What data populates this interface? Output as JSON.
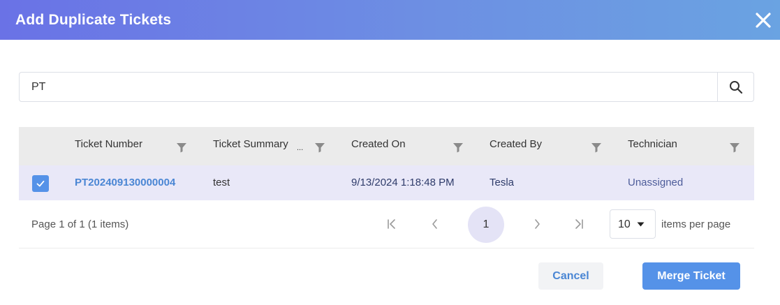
{
  "dialog": {
    "title": "Add Duplicate Tickets",
    "close_icon": "close-icon"
  },
  "search": {
    "value": "PT",
    "icon": "search-icon"
  },
  "grid": {
    "columns": [
      {
        "label": "Ticket Number"
      },
      {
        "label": "Ticket Summary",
        "truncated_marker": "..."
      },
      {
        "label": "Created On"
      },
      {
        "label": "Created By"
      },
      {
        "label": "Technician"
      }
    ],
    "rows": [
      {
        "selected": true,
        "ticket_number": "PT202409130000004",
        "summary": "test",
        "created_on": "9/13/2024 1:18:48 PM",
        "created_by": "Tesla",
        "technician": "Unassigned"
      }
    ]
  },
  "pager": {
    "info": "Page 1 of 1 (1 items)",
    "current_page": "1",
    "page_size": "10",
    "page_size_label": "items per page"
  },
  "actions": {
    "cancel_label": "Cancel",
    "merge_label": "Merge Ticket"
  },
  "colors": {
    "accent": "#5592e8",
    "link": "#4a86d4",
    "row_selected": "#e9e8f8",
    "header_grad_start": "#6a72e6",
    "header_grad_end": "#6aa3e2"
  }
}
